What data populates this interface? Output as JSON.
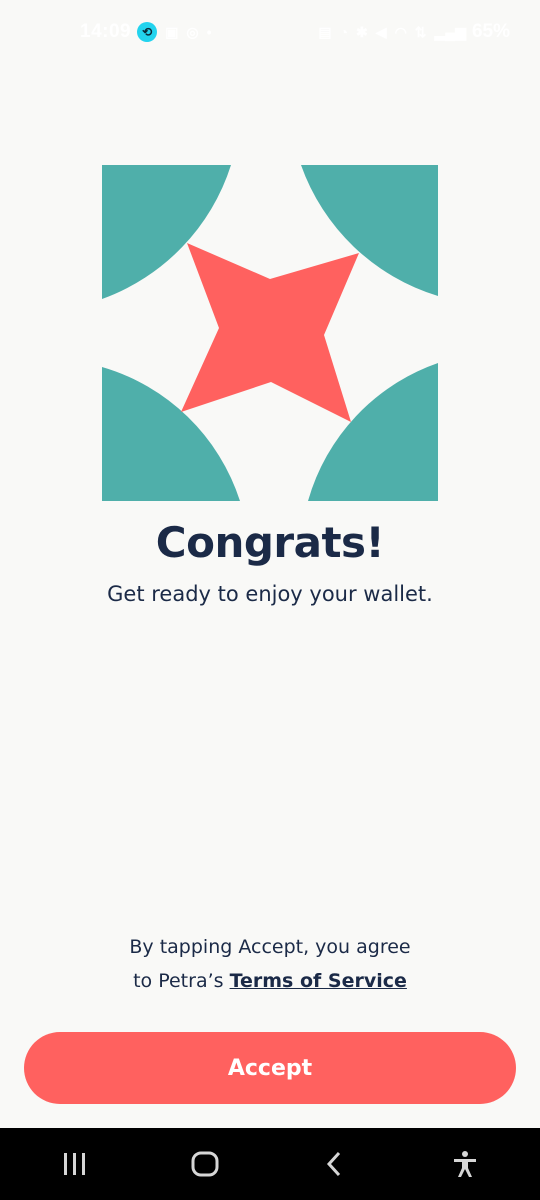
{
  "status_bar": {
    "time": "14:09",
    "battery": "65%"
  },
  "main": {
    "title": "Congrats!",
    "subtitle": "Get ready to enjoy your wallet."
  },
  "terms": {
    "line1": "By tapping Accept, you agree",
    "line2_prefix": "to Petra’s ",
    "link_label": "Terms of Service"
  },
  "accept_button": {
    "label": "Accept"
  },
  "colors": {
    "background": "#f9f9f7",
    "teal": "#4fafaa",
    "coral": "#ff615f",
    "navy": "#1b2a47"
  },
  "nav": {
    "icons": [
      "recent-apps-icon",
      "home-icon",
      "back-icon",
      "accessibility-icon"
    ]
  }
}
